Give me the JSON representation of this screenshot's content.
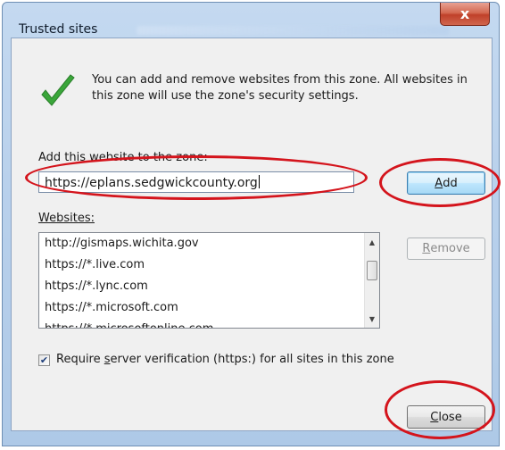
{
  "dialog": {
    "title": "Trusted sites",
    "close_glyph": "x"
  },
  "info": {
    "icon": "checkmark-icon",
    "text": "You can add and remove websites from this zone. All websites in this zone will use the zone's security settings."
  },
  "add_section": {
    "label": "Add this website to the zone:",
    "input_value": "https://eplans.sedgwickcounty.org",
    "add_button": "Add",
    "add_accesskey_letter": "A",
    "add_rest": "dd"
  },
  "websites": {
    "label": "Websites:",
    "items": [
      "http://gismaps.wichita.gov",
      "https://*.live.com",
      "https://*.lync.com",
      "https://*.microsoft.com",
      "https://*.microsoftonline.com"
    ],
    "remove_button": "Remove",
    "remove_accesskey_letter": "R",
    "remove_rest": "emove"
  },
  "verification": {
    "checked": true,
    "label_pre": "Require ",
    "label_accesskey": "s",
    "label_post": "erver verification (https:) for all sites in this zone"
  },
  "footer": {
    "close_button": "Close",
    "close_accesskey_letter": "C",
    "close_rest": "lose"
  },
  "colors": {
    "annotation": "#d4141c",
    "check_green": "#3aa63a"
  }
}
